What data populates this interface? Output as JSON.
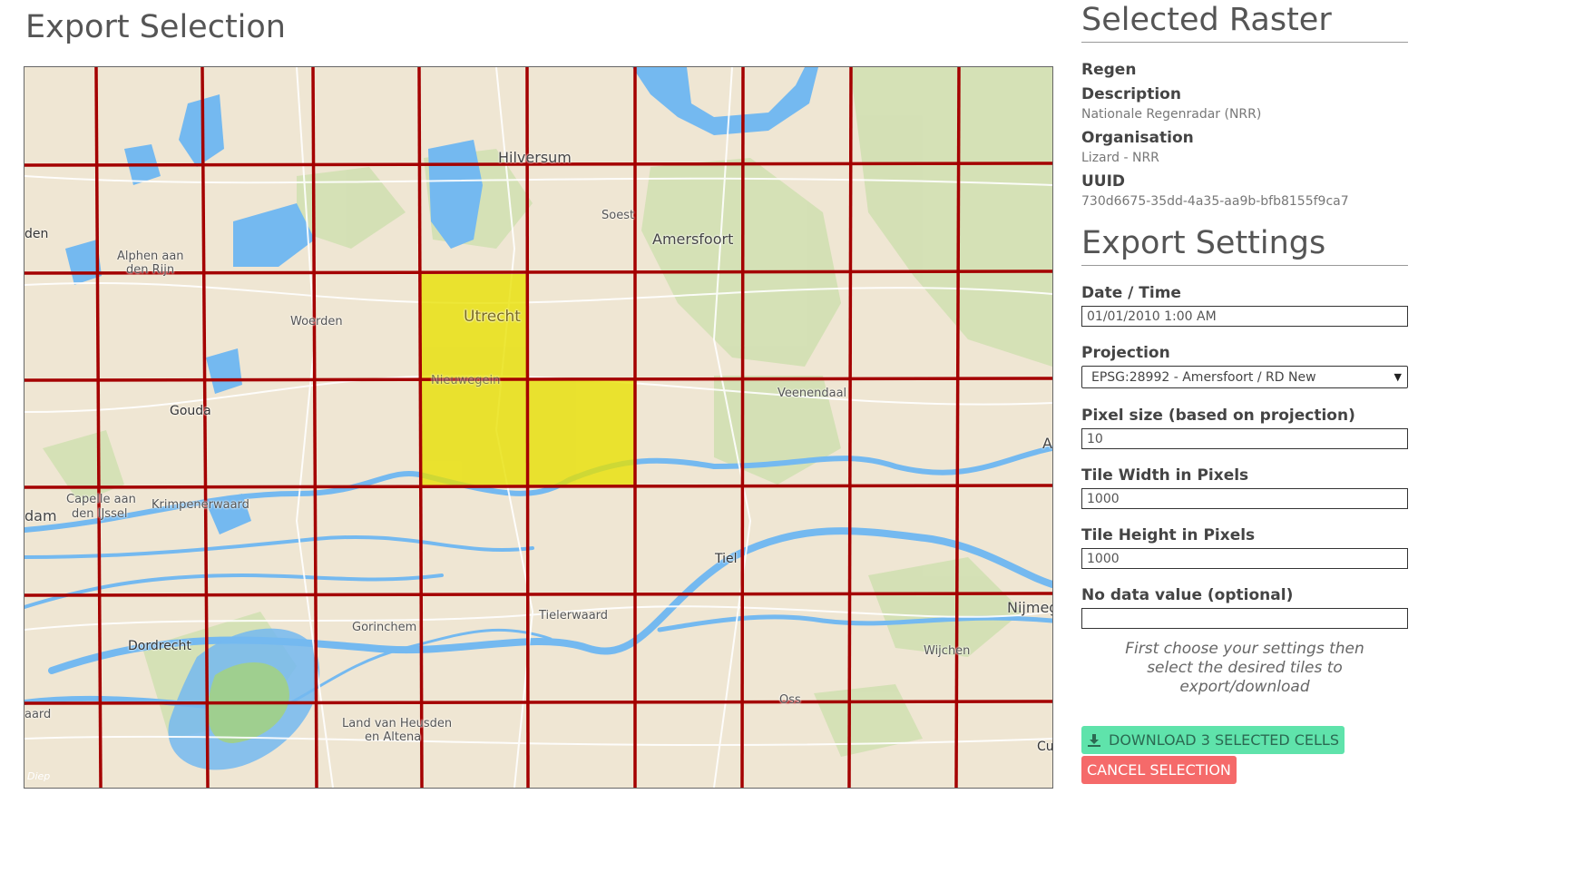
{
  "export_selection": {
    "title": "Export Selection"
  },
  "map": {
    "labels": {
      "hilversum": "Hilversum",
      "soest": "Soest",
      "amersfoort": "Amersfoort",
      "leiden_partial": "den",
      "alphen": "Alphen aan",
      "alphen2": "den Rijn",
      "woerden": "Woerden",
      "utrecht": "Utrecht",
      "nieuwegein": "Nieuwegein",
      "veenendaal": "Veenendaal",
      "gouda": "Gouda",
      "capelle": "Capelle aan",
      "capelle2": "den IJssel",
      "krimpenerwaard": "Krimpenerwaard",
      "rotterdam_partial": "dam",
      "tiel": "Tiel",
      "gorinchem": "Gorinchem",
      "tielerwaard": "Tielerwaard",
      "dordrecht": "Dordrecht",
      "wijchen": "Wijchen",
      "nijmegen_partial": "Nijmeg",
      "oss": "Oss",
      "land_heusden": "Land van Heusden",
      "land_heusden2": "en Altena",
      "breda_partial": "aard",
      "cuijk_partial": "Cu",
      "arnhem_partial": "A",
      "attribution": "Diep"
    },
    "selected_cells": 3,
    "colors": {
      "grid": "#a40000",
      "selected": "#e8e000",
      "water": "#74b9f0",
      "land": "#efe6d3",
      "green": "#d0dfb0"
    }
  },
  "raster": {
    "title": "Selected Raster",
    "name": "Regen",
    "description_label": "Description",
    "description": "Nationale Regenradar (NRR)",
    "organisation_label": "Organisation",
    "organisation": "Lizard - NRR",
    "uuid_label": "UUID",
    "uuid": "730d6675-35dd-4a35-aa9b-bfb8155f9ca7"
  },
  "settings": {
    "title": "Export Settings",
    "datetime_label": "Date / Time",
    "datetime_value": "01/01/2010 1:00 AM",
    "projection_label": "Projection",
    "projection_value": "EPSG:28992 - Amersfoort / RD New",
    "pixel_size_label": "Pixel size (based on projection)",
    "pixel_size_value": "10",
    "tile_width_label": "Tile Width in Pixels",
    "tile_width_value": "1000",
    "tile_height_label": "Tile Height in Pixels",
    "tile_height_value": "1000",
    "nodata_label": "No data value (optional)",
    "nodata_value": "",
    "hint_line1": "First choose your settings then",
    "hint_line2": "select the desired tiles to",
    "hint_line3": "export/download"
  },
  "buttons": {
    "download_label": "DOWNLOAD 3 SELECTED CELLS",
    "cancel_label": "CANCEL SELECTION"
  }
}
